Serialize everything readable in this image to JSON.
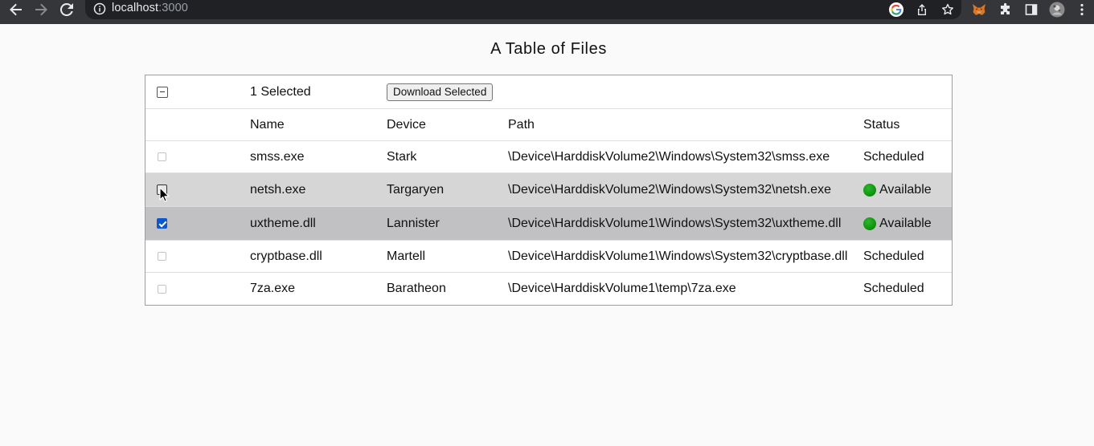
{
  "browser": {
    "url_host": "localhost",
    "url_port": ":3000",
    "back_icon": "back-arrow-icon",
    "forward_icon": "forward-arrow-icon",
    "reload_icon": "reload-icon",
    "info_icon": "site-info-icon",
    "right_icons": [
      "google-icon",
      "share-icon",
      "bookmark-star-icon",
      "metamask-fox-icon",
      "extensions-puzzle-icon",
      "side-panel-icon",
      "profile-avatar-icon",
      "more-menu-icon"
    ]
  },
  "page": {
    "title": "A Table of Files"
  },
  "toolbar": {
    "selected_count_label": "1 Selected",
    "download_button_label": "Download Selected"
  },
  "table": {
    "headers": {
      "name": "Name",
      "device": "Device",
      "path": "Path",
      "status": "Status"
    },
    "rows": [
      {
        "name": "smss.exe",
        "device": "Stark",
        "path": "\\Device\\HarddiskVolume2\\Windows\\System32\\smss.exe",
        "status": "Scheduled",
        "checked": false,
        "available": false
      },
      {
        "name": "netsh.exe",
        "device": "Targaryen",
        "path": "\\Device\\HarddiskVolume2\\Windows\\System32\\netsh.exe",
        "status": "Available",
        "checked": false,
        "available": true
      },
      {
        "name": "uxtheme.dll",
        "device": "Lannister",
        "path": "\\Device\\HarddiskVolume1\\Windows\\System32\\uxtheme.dll",
        "status": "Available",
        "checked": true,
        "available": true
      },
      {
        "name": "cryptbase.dll",
        "device": "Martell",
        "path": "\\Device\\HarddiskVolume1\\Windows\\System32\\cryptbase.dll",
        "status": "Scheduled",
        "checked": false,
        "available": false
      },
      {
        "name": "7za.exe",
        "device": "Baratheon",
        "path": "\\Device\\HarddiskVolume1\\temp\\7za.exe",
        "status": "Scheduled",
        "checked": false,
        "available": false
      }
    ]
  },
  "colors": {
    "chrome_bg": "#35363a",
    "omnibox_bg": "#202124",
    "hover_row_bg": "#d6d6d6",
    "selected_row_bg": "#c1c0c3",
    "available_dot": "#0f9a0f",
    "checkbox_checked": "#0b57d0"
  }
}
